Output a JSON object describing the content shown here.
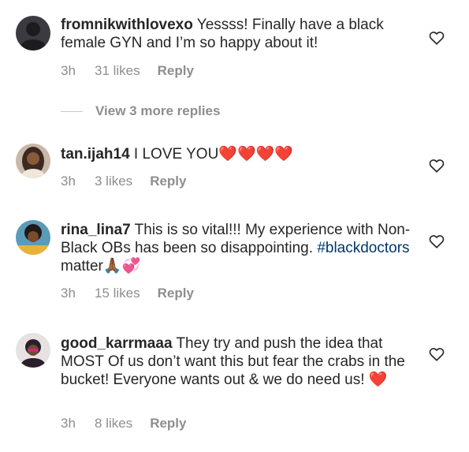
{
  "comments": [
    {
      "username": "fromnikwithlovexo",
      "text": " Yessss! Finally have a black female GYN and I’m so happy about it!",
      "time": "3h",
      "likes": "31 likes",
      "reply": "Reply",
      "avatar_color": "#2b2a30"
    },
    {
      "username": "tan.ijah14",
      "text": " I LOVE YOU",
      "emoji": "❤️❤️❤️❤️",
      "time": "3h",
      "likes": "3 likes",
      "reply": "Reply",
      "avatar_color": "#6a4a3a"
    },
    {
      "username": "rina_lina7",
      "text": " This is so vital!!! My experience with Non-Black OBs has been so disappointing. ",
      "hashtag": "#blackdoctors",
      "text_after": " matter",
      "emoji": "🙏🏾💞",
      "time": "3h",
      "likes": "15 likes",
      "reply": "Reply",
      "avatar_color": "#3a6e8f"
    },
    {
      "username": "good_karrmaaa",
      "text": " They try and push the idea that MOST Of us don’t want this but fear the crabs in the bucket! Everyone wants out & we do need us! ",
      "emoji": "❤️",
      "time": "3h",
      "likes": "8 likes",
      "reply": "Reply",
      "avatar_color": "#d9d9d9"
    }
  ],
  "view_more": "View 3 more replies",
  "colors": {
    "meta": "#8e8e8e",
    "hashtag": "#00376b",
    "text": "#262626"
  },
  "icons": {
    "like": "heart-outline-icon"
  }
}
